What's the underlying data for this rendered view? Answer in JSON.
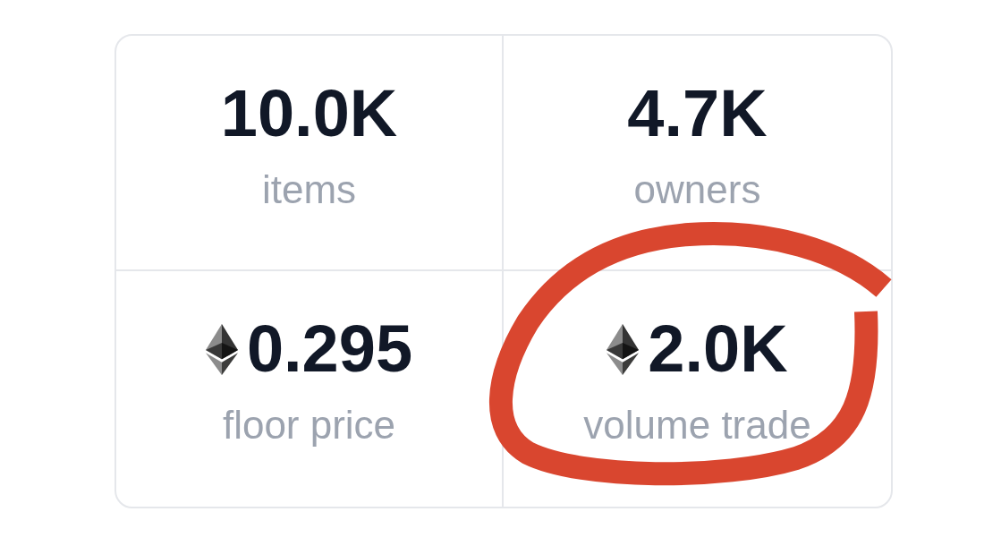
{
  "stats": [
    {
      "kind": "count",
      "value": "10.0K",
      "label": "items",
      "circled": false
    },
    {
      "kind": "count",
      "value": "4.7K",
      "label": "owners",
      "circled": false
    },
    {
      "kind": "eth",
      "value": "0.295",
      "label": "floor price",
      "circled": false
    },
    {
      "kind": "eth",
      "value": "2.0K",
      "label": "volume trade",
      "circled": true
    }
  ]
}
